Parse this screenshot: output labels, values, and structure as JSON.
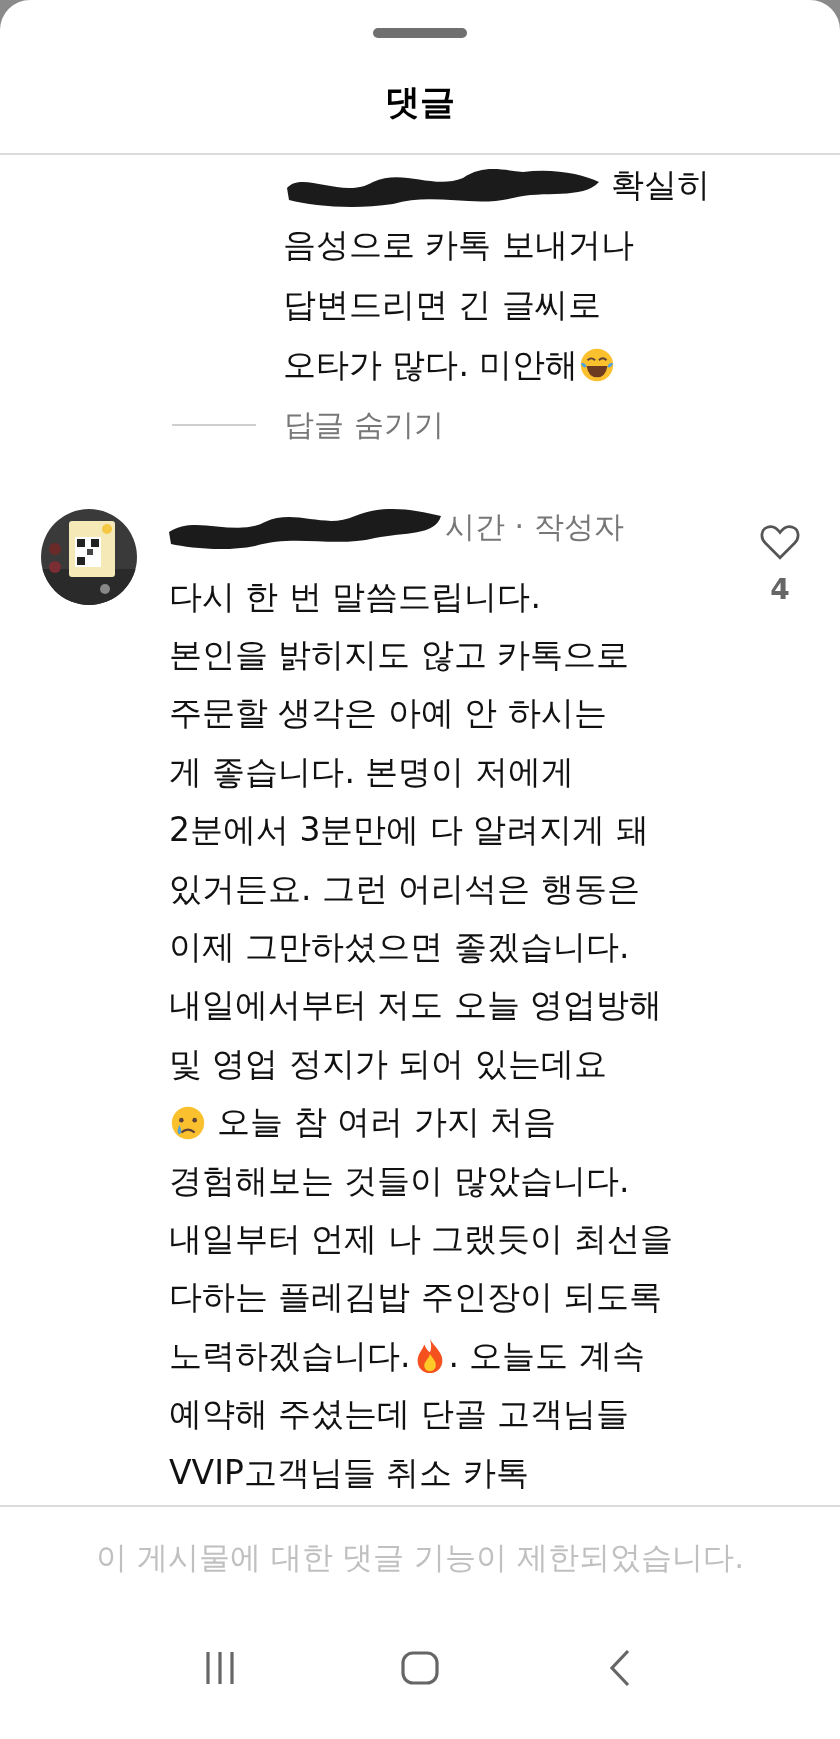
{
  "header": {
    "title": "댓글"
  },
  "reply": {
    "mention_redacted": true,
    "lines": [
      [
        {
          "kind": "text",
          "text": "확실히"
        }
      ],
      [
        {
          "kind": "text",
          "text": "음성으로 카톡 보내거나"
        }
      ],
      [
        {
          "kind": "text",
          "text": "답변드리면 긴 글씨로"
        }
      ],
      [
        {
          "kind": "text",
          "text": "오타가 많다. 미안해"
        },
        {
          "kind": "laugh"
        }
      ]
    ],
    "hide_label": "답글 숨기기"
  },
  "comment": {
    "author_redacted": true,
    "meta": "시간 · 작성자",
    "likes": "4",
    "liked": false,
    "lines": [
      [
        {
          "kind": "text",
          "text": "다시 한 번 말씀드립니다."
        }
      ],
      [
        {
          "kind": "text",
          "text": "본인을 밝히지도 않고 카톡으로"
        }
      ],
      [
        {
          "kind": "text",
          "text": "주문할 생각은 아예 안 하시는"
        }
      ],
      [
        {
          "kind": "text",
          "text": "게 좋습니다. 본명이 저에게"
        }
      ],
      [
        {
          "kind": "text",
          "text": "2분에서 3분만에 다 알려지게 돼"
        }
      ],
      [
        {
          "kind": "text",
          "text": "있거든요. 그런 어리석은 행동은"
        }
      ],
      [
        {
          "kind": "text",
          "text": "이제 그만하셨으면 좋겠습니다."
        }
      ],
      [
        {
          "kind": "text",
          "text": "내일에서부터 저도 오늘 영업방해"
        }
      ],
      [
        {
          "kind": "text",
          "text": "및 영업 정지가 되어 있는데요"
        }
      ],
      [
        {
          "kind": "sad"
        },
        {
          "kind": "text",
          "text": " 오늘 참 여러 가지 처음"
        }
      ],
      [
        {
          "kind": "text",
          "text": "경험해보는 것들이 많았습니다."
        }
      ],
      [
        {
          "kind": "text",
          "text": "내일부터 언제 나 그랬듯이 최선을"
        }
      ],
      [
        {
          "kind": "text",
          "text": "다하는 플레김밥 주인장이 되도록"
        }
      ],
      [
        {
          "kind": "text",
          "text": "노력하겠습니다."
        },
        {
          "kind": "fire"
        },
        {
          "kind": "text",
          "text": ". 오늘도 계속"
        }
      ],
      [
        {
          "kind": "text",
          "text": "예약해 주셨는데 단골 고객님들"
        }
      ],
      [
        {
          "kind": "text",
          "text": "VVIP고객님들 취소 카톡"
        }
      ]
    ]
  },
  "notice": "이 게시물에 대한 댓글 기능이 제한되었습니다."
}
